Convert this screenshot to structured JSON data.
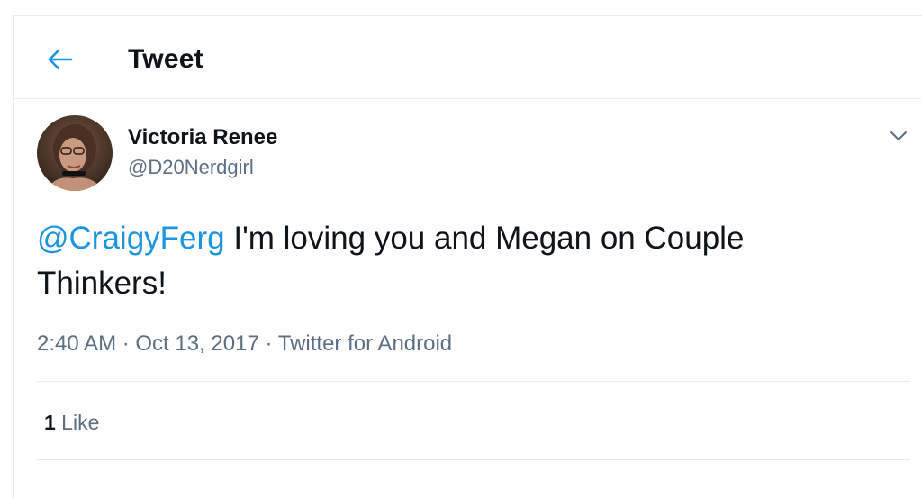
{
  "header": {
    "title": "Tweet",
    "back_icon": "arrow-left-icon"
  },
  "tweet": {
    "author": {
      "name": "Victoria Renee",
      "handle": "@D20Nerdgirl"
    },
    "mention": "@CraigyFerg",
    "body": " I'm loving you and Megan on Couple Thinkers!",
    "time": "2:40 AM",
    "separator": " · ",
    "date": "Oct 13, 2017",
    "source": "Twitter for Android",
    "likes_count": "1",
    "likes_label": " Like"
  },
  "colors": {
    "accent": "#1b95e0",
    "secondary_text": "#5b7083",
    "divider": "#e6ecf0"
  }
}
